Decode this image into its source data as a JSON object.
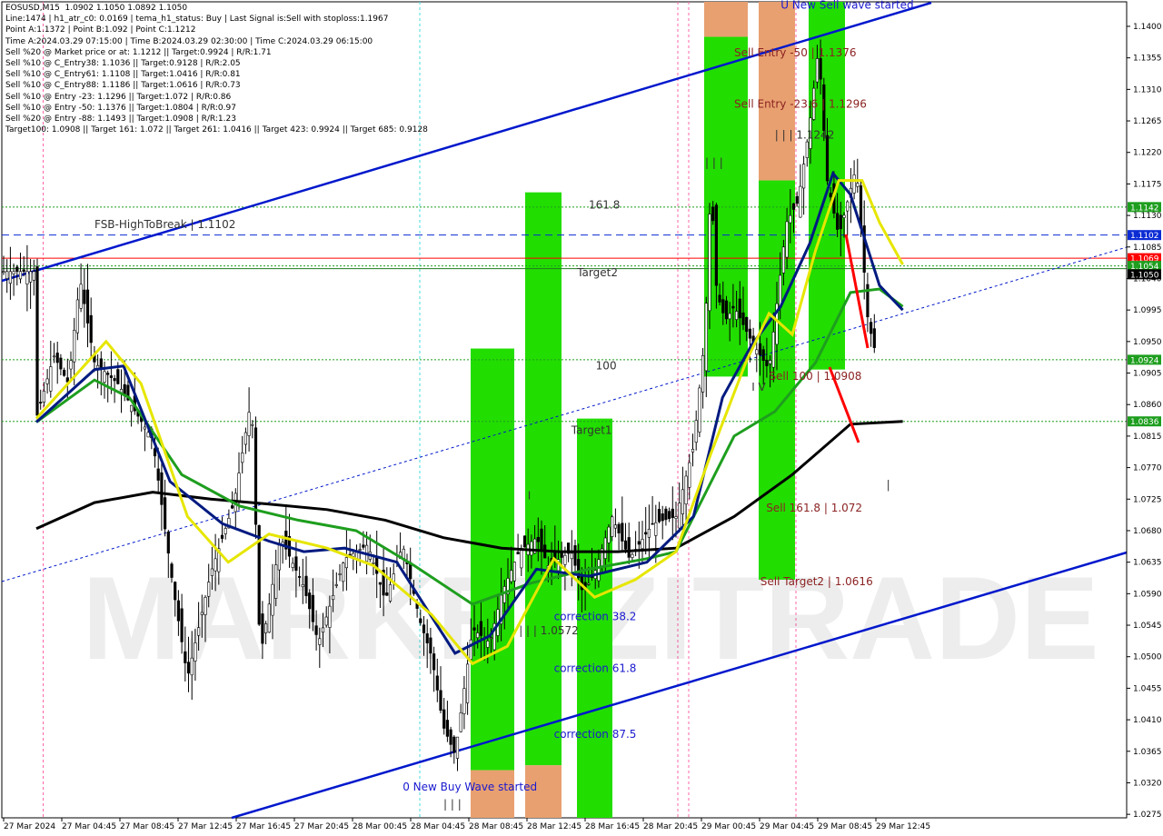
{
  "symbol_line": "EOSUSD,M15  1.0902 1.1050 1.0892 1.1050",
  "info_lines": [
    "Line:1474 | h1_atr_c0: 0.0169 | tema_h1_status: Buy | Last Signal is:Sell with stoploss:1.1967",
    "Point A:1.1372 | Point B:1.092 | Point C:1.1212",
    "Time A:2024.03.29 07:15:00 | Time B:2024.03.29 02:30:00 | Time C:2024.03.29 06:15:00",
    "Sell %20 @ Market price or at: 1.1212 || Target:0.9924 | R/R:1.71",
    "Sell %10 @ C_Entry38: 1.1036 || Target:0.9128 | R/R:2.05",
    "Sell %10 @ C_Entry61: 1.1108 || Target:1.0416 | R/R:0.81",
    "Sell %10 @ C_Entry88: 1.1186 || Target:1.0616 | R/R:0.73",
    "Sell %10 @ Entry -23: 1.1296 || Target:1.072 | R/R:0.86",
    "Sell %10 @ Entry -50: 1.1376 || Target:1.0804 | R/R:0.97",
    "Sell %20 @ Entry -88: 1.1493 || Target:1.0908 | R/R:1.23",
    "Target100: 1.0908 || Target 161: 1.072 || Target 261: 1.0416 || Target 423: 0.9924 || Target 685: 0.9128"
  ],
  "colors": {
    "green_zone": "#22dd00",
    "orange_zone": "#e8a070",
    "blue_line": "#0018cc",
    "red_line": "#ff0000",
    "dark_green": "#207a20",
    "price_red": "#ff0000",
    "price_blue": "#0a2bd4",
    "price_green": "#1e9e1e"
  },
  "chart_data": {
    "type": "candlestick",
    "price_axis": {
      "min": 1.027,
      "max": 1.1435
    },
    "y_ticks": [
      "1.1400",
      "1.1355",
      "1.1310",
      "1.1265",
      "1.1220",
      "1.1175",
      "1.1130",
      "1.1085",
      "1.1040",
      "1.0995",
      "1.0950",
      "1.0905",
      "1.0860",
      "1.0815",
      "1.0770",
      "1.0725",
      "1.0680",
      "1.0635",
      "1.0590",
      "1.0545",
      "1.0500",
      "1.0455",
      "1.0410",
      "1.0365",
      "1.0320",
      "1.0275"
    ],
    "x_ticks": [
      "27 Mar 2024",
      "27 Mar 04:45",
      "27 Mar 08:45",
      "27 Mar 12:45",
      "27 Mar 16:45",
      "27 Mar 20:45",
      "28 Mar 00:45",
      "28 Mar 04:45",
      "28 Mar 08:45",
      "28 Mar 12:45",
      "28 Mar 16:45",
      "28 Mar 20:45",
      "29 Mar 00:45",
      "29 Mar 04:45",
      "29 Mar 08:45",
      "29 Mar 12:45"
    ],
    "price_labels": [
      {
        "text": "1.1142",
        "price": 1.1142,
        "color": "green"
      },
      {
        "text": "1.1102",
        "price": 1.1102,
        "color": "blue"
      },
      {
        "text": "1.1069",
        "price": 1.1069,
        "color": "red"
      },
      {
        "text": "1.1054",
        "price": 1.1058,
        "color": "green"
      },
      {
        "text": "1.1050",
        "price": 1.1046,
        "color": "black"
      },
      {
        "text": "1.0924",
        "price": 1.0924,
        "color": "green"
      },
      {
        "text": "1.0836",
        "price": 1.0836,
        "color": "green"
      }
    ],
    "levels": [
      {
        "price": 1.1142,
        "style": "dotted",
        "color": "green"
      },
      {
        "price": 1.1102,
        "style": "dashed",
        "color": "blue"
      },
      {
        "price": 1.1069,
        "style": "solid",
        "color": "red"
      },
      {
        "price": 1.1058,
        "style": "dotted",
        "color": "green"
      },
      {
        "price": 1.1054,
        "style": "solid",
        "color": "darkgreen"
      },
      {
        "price": 1.0924,
        "style": "dotted",
        "color": "green"
      },
      {
        "price": 1.0836,
        "style": "dotted",
        "color": "green"
      }
    ],
    "annotations": [
      {
        "text": "U New Sell wave started",
        "price": 1.1425,
        "time": 12.8
      },
      {
        "text": "Sell Entry -50 | 1.1376",
        "price": 1.1357,
        "time": 12.0
      },
      {
        "text": "Sell Entry -23.6 | 1.1296",
        "price": 1.1284,
        "time": 12.0
      },
      {
        "text": "| | | 1.1242",
        "price": 1.124,
        "time": 12.7
      },
      {
        "text": "| | |",
        "price": 1.12,
        "time": 11.5
      },
      {
        "text": "161.8",
        "price": 1.114,
        "time": 9.5
      },
      {
        "text": "FSB-HighToBreak | 1.1102",
        "price": 1.1112,
        "time": 1.0
      },
      {
        "text": "Target2",
        "price": 1.1043,
        "time": 9.3
      },
      {
        "text": "100",
        "price": 1.091,
        "time": 9.62
      },
      {
        "text": "Sell 100 | 1.0908",
        "price": 1.0895,
        "time": 12.6
      },
      {
        "text": "I V",
        "price": 1.088,
        "time": 12.3
      },
      {
        "text": "Target1",
        "price": 1.0818,
        "time": 9.2
      },
      {
        "text": "Sell 161.8 | 1.072",
        "price": 1.0707,
        "time": 12.55
      },
      {
        "text": "Sell Target2 | 1.0616",
        "price": 1.0602,
        "time": 12.45
      },
      {
        "text": "correction 38.2",
        "price": 1.0552,
        "time": 8.9
      },
      {
        "text": "| | | 1.0572",
        "price": 1.0532,
        "time": 8.3
      },
      {
        "text": "correction 61.8",
        "price": 1.0478,
        "time": 8.9
      },
      {
        "text": "correction 87.5",
        "price": 1.0384,
        "time": 8.9
      },
      {
        "text": "0 New Buy Wave started",
        "price": 1.0309,
        "time": 6.3
      },
      {
        "text": "| | |",
        "price": 1.0284,
        "time": 7.0
      },
      {
        "text": "|",
        "price": 1.074,
        "time": 14.62
      },
      {
        "text": "I",
        "price": 1.0725,
        "time": 8.45
      }
    ],
    "series": [
      {
        "name": "",
        "color": "black",
        "points": [
          [
            0,
            1.0683
          ],
          [
            1,
            1.072
          ],
          [
            2,
            1.0735
          ],
          [
            3,
            1.0725
          ],
          [
            4,
            1.0718
          ],
          [
            5,
            1.071
          ],
          [
            6,
            1.0695
          ],
          [
            7,
            1.067
          ],
          [
            8,
            1.0655
          ],
          [
            9,
            1.065
          ],
          [
            10,
            1.065
          ],
          [
            11,
            1.0655
          ],
          [
            12,
            1.07
          ],
          [
            13,
            1.076
          ],
          [
            14,
            1.0832
          ],
          [
            14.9,
            1.0836
          ]
        ]
      },
      {
        "name": "",
        "color": "#1e9e1e",
        "points": [
          [
            0,
            1.0835
          ],
          [
            1,
            1.0895
          ],
          [
            1.6,
            1.087
          ],
          [
            2.5,
            1.076
          ],
          [
            3.5,
            1.0715
          ],
          [
            4.5,
            1.0695
          ],
          [
            5.5,
            1.068
          ],
          [
            6.5,
            1.063
          ],
          [
            7.5,
            1.0575
          ],
          [
            8.5,
            1.0605
          ],
          [
            9.5,
            1.0625
          ],
          [
            10.5,
            1.064
          ],
          [
            11,
            1.065
          ],
          [
            12,
            1.0815
          ],
          [
            12.7,
            1.085
          ],
          [
            13.4,
            1.092
          ],
          [
            14,
            1.102
          ],
          [
            14.5,
            1.1025
          ],
          [
            14.9,
            1.1
          ]
        ]
      },
      {
        "name": "",
        "color": "#001a80",
        "points": [
          [
            0,
            1.0835
          ],
          [
            1,
            1.091
          ],
          [
            1.5,
            1.0915
          ],
          [
            2.3,
            1.075
          ],
          [
            3.2,
            1.069
          ],
          [
            4,
            1.0665
          ],
          [
            4.6,
            1.065
          ],
          [
            5.3,
            1.0655
          ],
          [
            6.2,
            1.0635
          ],
          [
            7.2,
            1.0505
          ],
          [
            7.8,
            1.053
          ],
          [
            8.6,
            1.0625
          ],
          [
            9.5,
            1.0615
          ],
          [
            10.5,
            1.0635
          ],
          [
            11.3,
            1.07
          ],
          [
            11.8,
            1.087
          ],
          [
            12.3,
            1.0945
          ],
          [
            12.8,
            1.1
          ],
          [
            13.3,
            1.109
          ],
          [
            13.7,
            1.119
          ],
          [
            14,
            1.116
          ],
          [
            14.5,
            1.103
          ],
          [
            14.9,
            1.0995
          ]
        ]
      },
      {
        "name": "",
        "color": "#e6e600",
        "points": [
          [
            0,
            1.084
          ],
          [
            1.2,
            1.095
          ],
          [
            1.8,
            1.089
          ],
          [
            2.6,
            1.07
          ],
          [
            3.3,
            1.0635
          ],
          [
            4,
            1.0675
          ],
          [
            5,
            1.0655
          ],
          [
            5.8,
            1.063
          ],
          [
            6.8,
            1.056
          ],
          [
            7.5,
            1.049
          ],
          [
            8.1,
            1.0515
          ],
          [
            8.9,
            1.064
          ],
          [
            9.6,
            1.0585
          ],
          [
            10.3,
            1.061
          ],
          [
            11,
            1.065
          ],
          [
            11.6,
            1.079
          ],
          [
            12.2,
            1.092
          ],
          [
            12.6,
            1.099
          ],
          [
            13,
            1.096
          ],
          [
            13.4,
            1.108
          ],
          [
            13.8,
            1.118
          ],
          [
            14.2,
            1.118
          ],
          [
            14.5,
            1.112
          ],
          [
            14.9,
            1.106
          ]
        ]
      }
    ]
  }
}
